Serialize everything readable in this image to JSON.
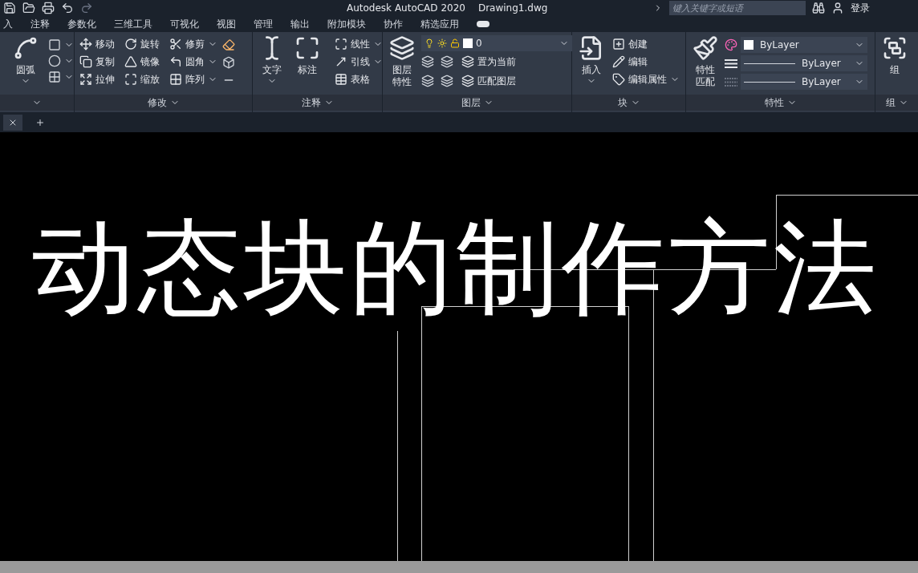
{
  "title_bar": {
    "app_title": "Autodesk AutoCAD 2020",
    "file_name": "Drawing1.dwg",
    "search": {
      "placeholder": "键入关键字或短语"
    },
    "sign_in": "登录"
  },
  "ribbon_tabs": [
    {
      "label": "入"
    },
    {
      "label": "注释"
    },
    {
      "label": "参数化"
    },
    {
      "label": "三维工具"
    },
    {
      "label": "可视化"
    },
    {
      "label": "视图"
    },
    {
      "label": "管理"
    },
    {
      "label": "输出"
    },
    {
      "label": "附加模块"
    },
    {
      "label": "协作"
    },
    {
      "label": "精选应用"
    }
  ],
  "panels": [
    {
      "kind": "draw",
      "large": {
        "label_lines": [
          "圆弧"
        ],
        "dropdown": true
      }
    },
    {
      "kind": "modify",
      "title": "修改",
      "tools": [
        {
          "label": "移动",
          "dropdown": false
        },
        {
          "label": "旋转",
          "dropdown": false
        },
        {
          "label": "修剪",
          "dropdown": true
        },
        {
          "label": "复制",
          "dropdown": false
        },
        {
          "label": "镜像",
          "dropdown": false
        },
        {
          "label": "圆角",
          "dropdown": true
        },
        {
          "label": "拉伸",
          "dropdown": false
        },
        {
          "label": "缩放",
          "dropdown": false
        },
        {
          "label": "阵列",
          "dropdown": true
        }
      ]
    },
    {
      "kind": "annotate",
      "title": "注释",
      "large": [
        {
          "label_lines": [
            "文字"
          ],
          "dropdown": true
        },
        {
          "label_lines": [
            "标注"
          ],
          "dropdown": false
        }
      ],
      "tools": [
        {
          "label": "线性",
          "dropdown": true
        },
        {
          "label": "引线",
          "dropdown": true
        },
        {
          "label": "表格",
          "dropdown": false
        }
      ]
    },
    {
      "kind": "layers",
      "title": "图层",
      "large": {
        "label_lines": [
          "图层",
          "特性"
        ],
        "dropdown": false
      },
      "layer_select": {
        "value": "0"
      },
      "tools": [
        {
          "label": "置为当前",
          "dropdown": false
        },
        {
          "label": "匹配图层",
          "dropdown": false
        }
      ]
    },
    {
      "kind": "block",
      "title": "块",
      "large": {
        "label_lines": [
          "插入"
        ],
        "dropdown": true
      },
      "tools": [
        {
          "label": "创建",
          "dropdown": false
        },
        {
          "label": "编辑",
          "dropdown": false
        },
        {
          "label": "编辑属性",
          "dropdown": true
        }
      ]
    },
    {
      "kind": "properties",
      "title": "特性",
      "large": {
        "label_lines": [
          "特性",
          "匹配"
        ],
        "dropdown": false
      },
      "selects": [
        {
          "kind": "color",
          "value": "ByLayer"
        },
        {
          "kind": "linetype",
          "value": "ByLayer"
        },
        {
          "kind": "lineweight",
          "value": "ByLayer"
        }
      ]
    },
    {
      "kind": "group",
      "title": "组",
      "large": {
        "label_lines": [
          "组"
        ],
        "dropdown": false
      }
    }
  ],
  "caption": "动态块的制作方法"
}
